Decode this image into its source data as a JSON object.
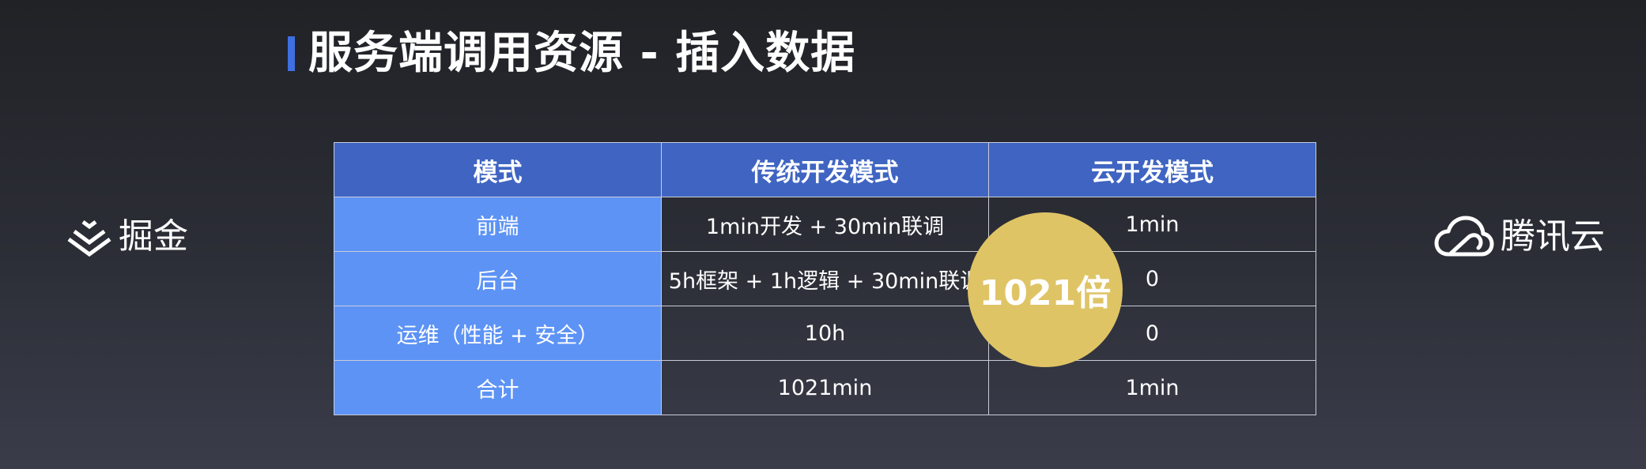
{
  "slide": {
    "title": "服务端调用资源 - 插入数据",
    "accent_color": "#3f6fe0"
  },
  "logos": {
    "left": {
      "text": "掘金",
      "icon": "juejin-logo-icon"
    },
    "right": {
      "text": "腾讯云",
      "icon": "cloud-logo-icon"
    }
  },
  "table": {
    "header_color": "#3f64c2",
    "mode_column_color": "#5d93f5",
    "headers": [
      "模式",
      "传统开发模式",
      "云开发模式"
    ],
    "rows": [
      {
        "mode": "前端",
        "traditional": "1min开发 + 30min联调",
        "cloud": "1min"
      },
      {
        "mode": "后台",
        "traditional": "5h框架 + 1h逻辑 + 30min联调",
        "cloud": "0"
      },
      {
        "mode": "运维（性能 + 安全）",
        "traditional": "10h",
        "cloud": "0"
      },
      {
        "mode": "合计",
        "traditional": "1021min",
        "cloud": "1min"
      }
    ]
  },
  "badge": {
    "text": "1021倍",
    "color": "#dfc466"
  }
}
